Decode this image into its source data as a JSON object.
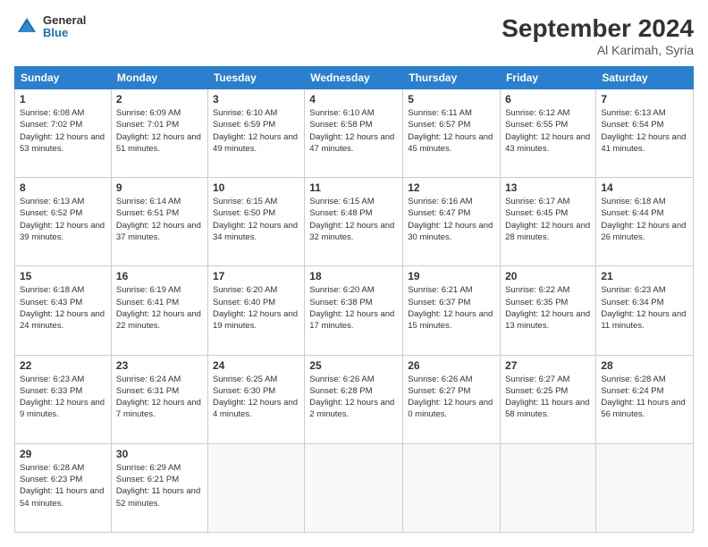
{
  "header": {
    "logo": {
      "general": "General",
      "blue": "Blue"
    },
    "title": "September 2024",
    "location": "Al Karimah, Syria"
  },
  "calendar": {
    "days_of_week": [
      "Sunday",
      "Monday",
      "Tuesday",
      "Wednesday",
      "Thursday",
      "Friday",
      "Saturday"
    ],
    "weeks": [
      [
        null,
        {
          "day": 2,
          "sunrise": "6:09 AM",
          "sunset": "7:01 PM",
          "daylight": "12 hours and 51 minutes."
        },
        {
          "day": 3,
          "sunrise": "6:10 AM",
          "sunset": "6:59 PM",
          "daylight": "12 hours and 49 minutes."
        },
        {
          "day": 4,
          "sunrise": "6:10 AM",
          "sunset": "6:58 PM",
          "daylight": "12 hours and 47 minutes."
        },
        {
          "day": 5,
          "sunrise": "6:11 AM",
          "sunset": "6:57 PM",
          "daylight": "12 hours and 45 minutes."
        },
        {
          "day": 6,
          "sunrise": "6:12 AM",
          "sunset": "6:55 PM",
          "daylight": "12 hours and 43 minutes."
        },
        {
          "day": 7,
          "sunrise": "6:13 AM",
          "sunset": "6:54 PM",
          "daylight": "12 hours and 41 minutes."
        }
      ],
      [
        {
          "day": 1,
          "sunrise": "6:08 AM",
          "sunset": "7:02 PM",
          "daylight": "12 hours and 53 minutes."
        },
        null,
        null,
        null,
        null,
        null,
        null
      ],
      [
        {
          "day": 8,
          "sunrise": "6:13 AM",
          "sunset": "6:52 PM",
          "daylight": "12 hours and 39 minutes."
        },
        {
          "day": 9,
          "sunrise": "6:14 AM",
          "sunset": "6:51 PM",
          "daylight": "12 hours and 37 minutes."
        },
        {
          "day": 10,
          "sunrise": "6:15 AM",
          "sunset": "6:50 PM",
          "daylight": "12 hours and 34 minutes."
        },
        {
          "day": 11,
          "sunrise": "6:15 AM",
          "sunset": "6:48 PM",
          "daylight": "12 hours and 32 minutes."
        },
        {
          "day": 12,
          "sunrise": "6:16 AM",
          "sunset": "6:47 PM",
          "daylight": "12 hours and 30 minutes."
        },
        {
          "day": 13,
          "sunrise": "6:17 AM",
          "sunset": "6:45 PM",
          "daylight": "12 hours and 28 minutes."
        },
        {
          "day": 14,
          "sunrise": "6:18 AM",
          "sunset": "6:44 PM",
          "daylight": "12 hours and 26 minutes."
        }
      ],
      [
        {
          "day": 15,
          "sunrise": "6:18 AM",
          "sunset": "6:43 PM",
          "daylight": "12 hours and 24 minutes."
        },
        {
          "day": 16,
          "sunrise": "6:19 AM",
          "sunset": "6:41 PM",
          "daylight": "12 hours and 22 minutes."
        },
        {
          "day": 17,
          "sunrise": "6:20 AM",
          "sunset": "6:40 PM",
          "daylight": "12 hours and 19 minutes."
        },
        {
          "day": 18,
          "sunrise": "6:20 AM",
          "sunset": "6:38 PM",
          "daylight": "12 hours and 17 minutes."
        },
        {
          "day": 19,
          "sunrise": "6:21 AM",
          "sunset": "6:37 PM",
          "daylight": "12 hours and 15 minutes."
        },
        {
          "day": 20,
          "sunrise": "6:22 AM",
          "sunset": "6:35 PM",
          "daylight": "12 hours and 13 minutes."
        },
        {
          "day": 21,
          "sunrise": "6:23 AM",
          "sunset": "6:34 PM",
          "daylight": "12 hours and 11 minutes."
        }
      ],
      [
        {
          "day": 22,
          "sunrise": "6:23 AM",
          "sunset": "6:33 PM",
          "daylight": "12 hours and 9 minutes."
        },
        {
          "day": 23,
          "sunrise": "6:24 AM",
          "sunset": "6:31 PM",
          "daylight": "12 hours and 7 minutes."
        },
        {
          "day": 24,
          "sunrise": "6:25 AM",
          "sunset": "6:30 PM",
          "daylight": "12 hours and 4 minutes."
        },
        {
          "day": 25,
          "sunrise": "6:26 AM",
          "sunset": "6:28 PM",
          "daylight": "12 hours and 2 minutes."
        },
        {
          "day": 26,
          "sunrise": "6:26 AM",
          "sunset": "6:27 PM",
          "daylight": "12 hours and 0 minutes."
        },
        {
          "day": 27,
          "sunrise": "6:27 AM",
          "sunset": "6:25 PM",
          "daylight": "11 hours and 58 minutes."
        },
        {
          "day": 28,
          "sunrise": "6:28 AM",
          "sunset": "6:24 PM",
          "daylight": "11 hours and 56 minutes."
        }
      ],
      [
        {
          "day": 29,
          "sunrise": "6:28 AM",
          "sunset": "6:23 PM",
          "daylight": "11 hours and 54 minutes."
        },
        {
          "day": 30,
          "sunrise": "6:29 AM",
          "sunset": "6:21 PM",
          "daylight": "11 hours and 52 minutes."
        },
        null,
        null,
        null,
        null,
        null
      ]
    ]
  }
}
